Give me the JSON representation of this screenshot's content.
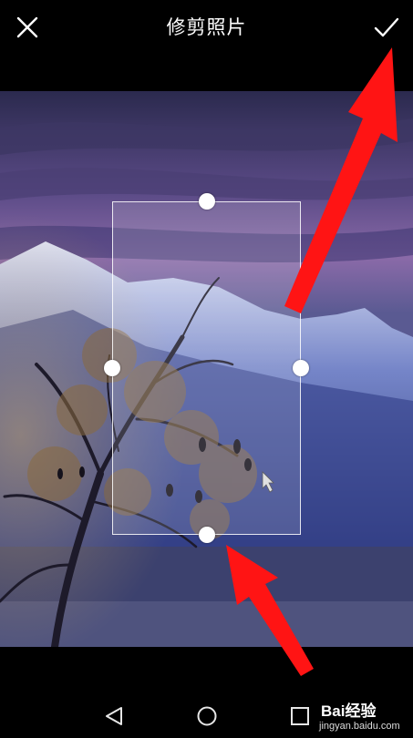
{
  "header": {
    "title": "修剪照片",
    "close_icon": "close-icon",
    "confirm_icon": "check-icon"
  },
  "editor": {
    "image_description_colors": {
      "sky_top": "#2a2a52",
      "sky_mid": "#6f4f92",
      "mountain": "#3b4fa8",
      "snow": "#d7dcf3",
      "lake": "#4a4f7a"
    },
    "crop_handles": [
      "top",
      "bottom",
      "left",
      "right"
    ],
    "annotation_color": "#ff1a1a"
  },
  "navigation": {
    "back_icon": "back-triangle-icon",
    "home_icon": "home-circle-icon",
    "recent_icon": "recent-square-icon"
  },
  "watermark": {
    "brand": "Bai经验",
    "url": "jingyan.baidu.com"
  }
}
